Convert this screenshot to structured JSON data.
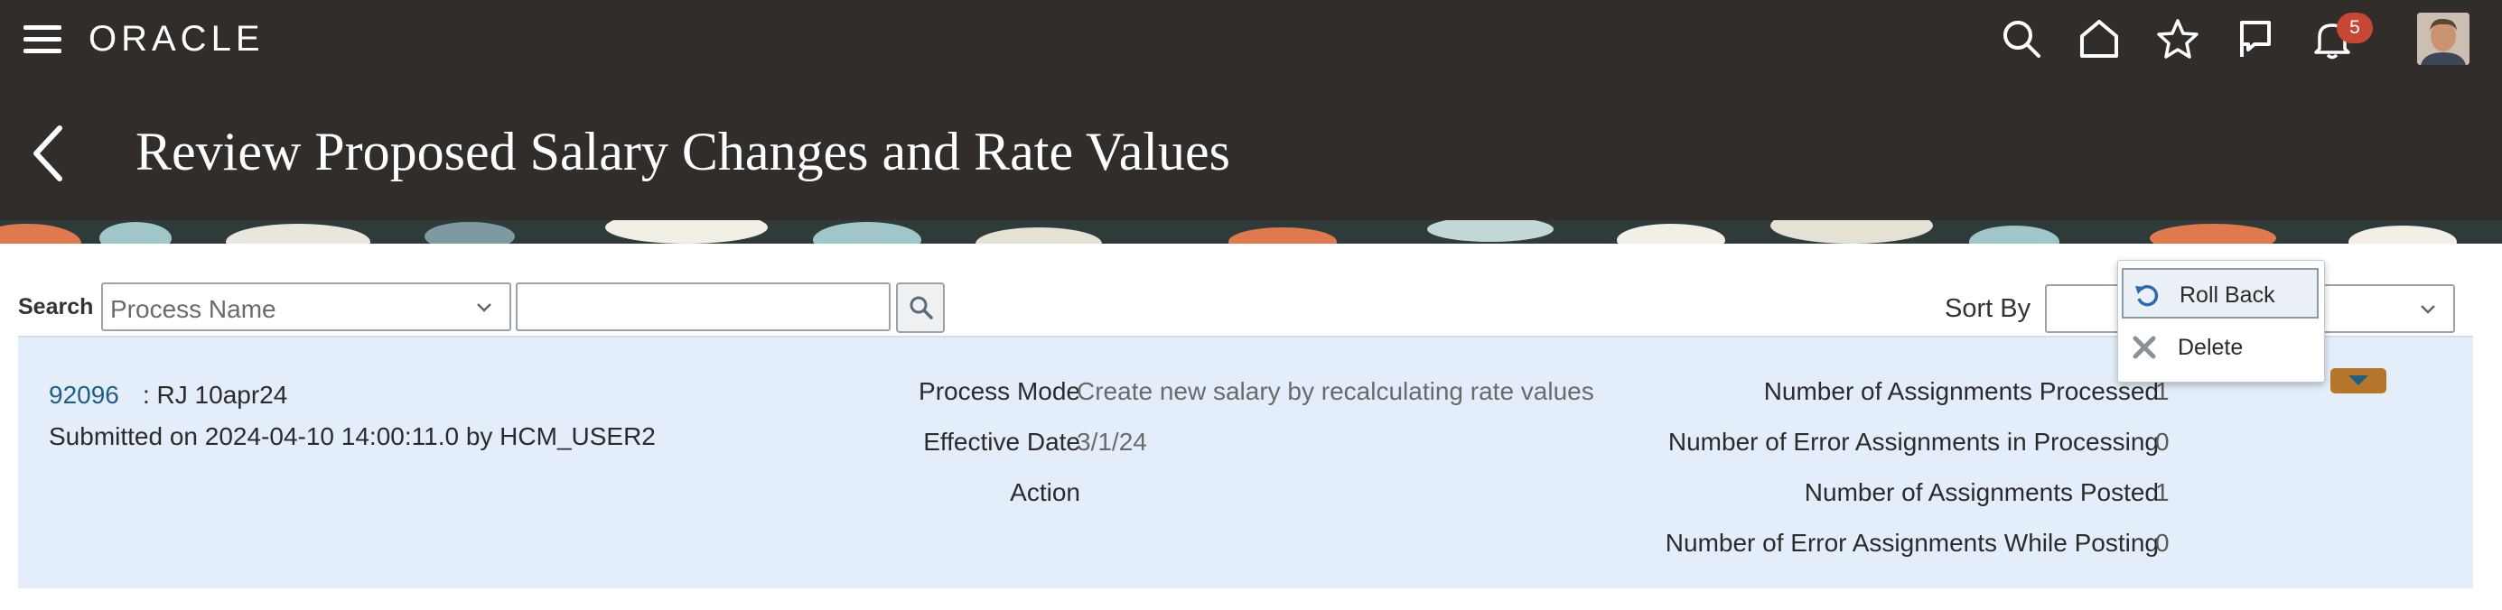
{
  "header": {
    "logo_text": "ORACLE",
    "notifications_count": "5",
    "page_title": "Review Proposed Salary Changes and Rate Values"
  },
  "search": {
    "label": "Search",
    "field_value": "Process Name",
    "text_value": ""
  },
  "sort": {
    "label": "Sort By",
    "value": ""
  },
  "result": {
    "request_id": "92096",
    "request_name": ": RJ 10apr24",
    "submitted_text": "Submitted on 2024-04-10 14:00:11.0 by HCM_USER2",
    "process_mode_label": "Process Mode",
    "process_mode_value": "Create new salary by recalculating rate values",
    "effective_date_label": "Effective Date",
    "effective_date_value": "3/1/24",
    "action_label": "Action",
    "assignments_processed_label": "Number of Assignments Processed",
    "assignments_processed_value": "1",
    "error_processing_label": "Number of Error Assignments in Processing",
    "error_processing_value": "0",
    "assignments_posted_label": "Number of Assignments Posted",
    "assignments_posted_value": "1",
    "error_posting_label": "Number of Error Assignments While Posting",
    "error_posting_value": "0"
  },
  "menu": {
    "items": [
      {
        "label": "Roll Back",
        "icon": "rollback-icon"
      },
      {
        "label": "Delete",
        "icon": "delete-icon"
      }
    ]
  },
  "colors": {
    "header_bg": "#312d2a",
    "panel_bg": "#e4eefa",
    "link": "#1f5e86",
    "badge": "#c74634",
    "action_button": "#b7762b"
  }
}
